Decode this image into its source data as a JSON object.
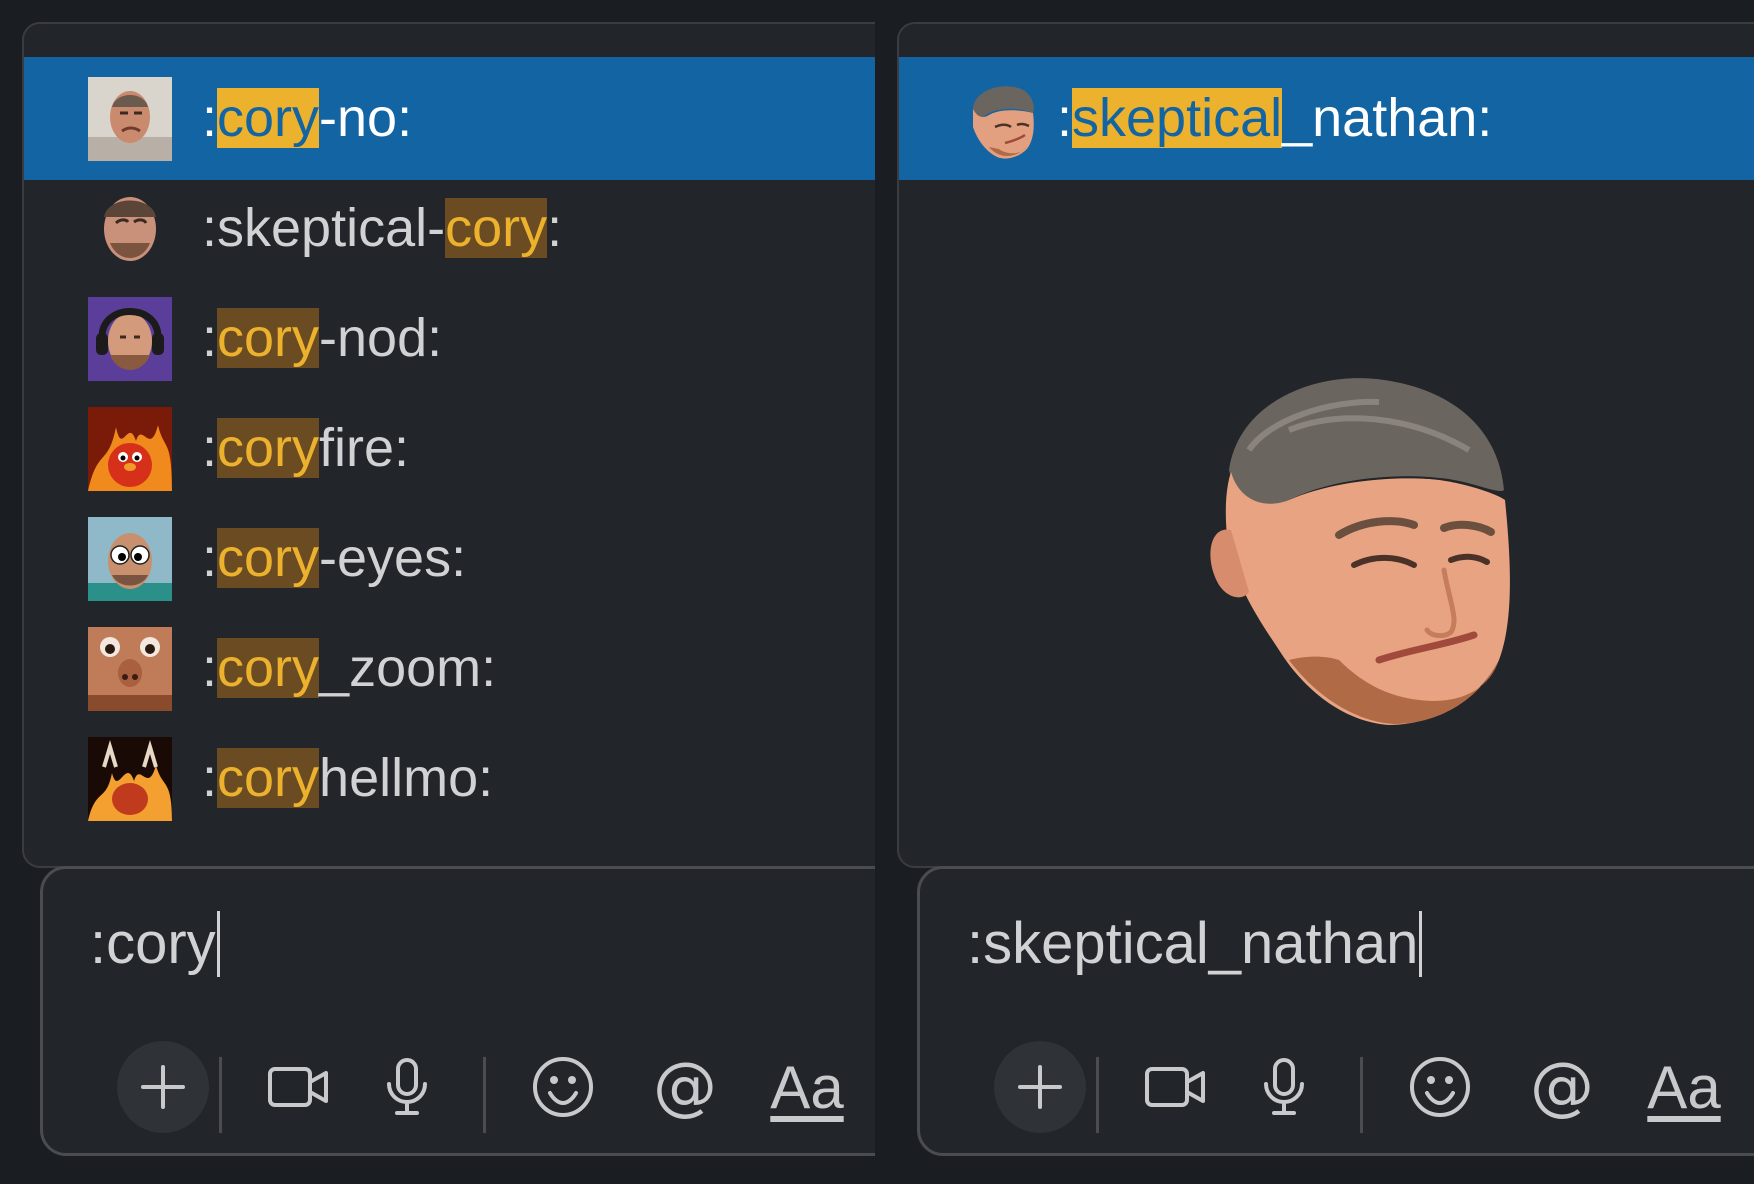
{
  "left": {
    "composer_text": ":cory",
    "items": [
      {
        "pre": ":",
        "hl": "cory",
        "post": "-no:",
        "selected": true,
        "icon": "man-frowning-face-emoji"
      },
      {
        "pre": ":skeptical-",
        "hl": "cory",
        "post": ":",
        "selected": false,
        "icon": "skeptical-man-face-emoji"
      },
      {
        "pre": ":",
        "hl": "cory",
        "post": "-nod:",
        "selected": false,
        "icon": "man-headphones-emoji"
      },
      {
        "pre": ":",
        "hl": "cory",
        "post": "fire:",
        "selected": false,
        "icon": "fire-monster-emoji"
      },
      {
        "pre": ":",
        "hl": "cory",
        "post": "-eyes:",
        "selected": false,
        "icon": "googly-eyes-emoji"
      },
      {
        "pre": ":",
        "hl": "cory",
        "post": "_zoom:",
        "selected": false,
        "icon": "zoomed-face-emoji"
      },
      {
        "pre": ":",
        "hl": "cory",
        "post": "hellmo:",
        "selected": false,
        "icon": "hellmo-fire-emoji"
      }
    ]
  },
  "right": {
    "composer_text": ":skeptical_nathan",
    "items": [
      {
        "pre": ":",
        "hl": "skeptical",
        "post": "_nathan:",
        "selected": true,
        "icon": "skeptical-nathan-emoji"
      }
    ],
    "preview_icon": "skeptical-nathan-large-preview"
  },
  "toolbar_icons": [
    "plus-icon",
    "video-icon",
    "microphone-icon",
    "emoji-icon",
    "mention-icon",
    "formatting-icon"
  ],
  "toolbar_format_label": "Aa",
  "toolbar_mention_label": "@",
  "colors": {
    "selected_row": "#1264a3",
    "highlight": "#ecb22e",
    "highlight_bg": "#6a4b22",
    "panel": "#222529",
    "page": "#1a1d21"
  }
}
